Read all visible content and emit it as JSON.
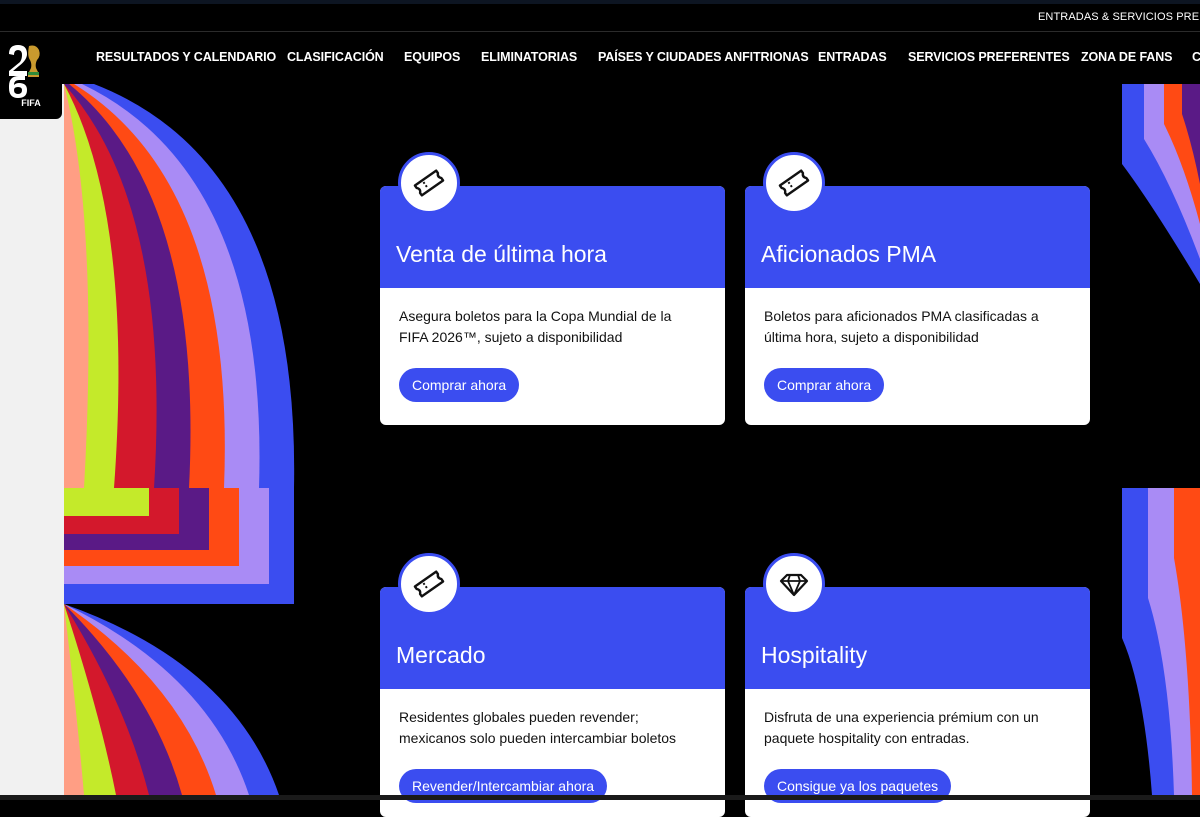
{
  "topbar": {
    "link": "ENTRADAS & SERVICIOS PREFERE"
  },
  "logo": {
    "text": "FIFA",
    "numerals": "26"
  },
  "nav": {
    "items": [
      "RESULTADOS Y CALENDARIO",
      "CLASIFICACIÓN",
      "EQUIPOS",
      "ELIMINATORIAS",
      "PAÍSES Y CIUDADES ANFITRIONAS",
      "ENTRADAS",
      "SERVICIOS PREFERENTES",
      "ZONA DE FANS",
      "C"
    ]
  },
  "cards": [
    {
      "icon": "ticket-icon",
      "title": "Venta de última hora",
      "desc": "Asegura boletos para la Copa Mundial de la FIFA 2026™, sujeto a disponibilidad",
      "button": "Comprar ahora"
    },
    {
      "icon": "ticket-icon",
      "title": "Aficionados PMA",
      "desc": "Boletos para aficionados PMA clasificadas a última hora, sujeto a disponibilidad",
      "button": "Comprar ahora"
    },
    {
      "icon": "ticket-icon",
      "title": "Mercado",
      "desc": "Residentes globales pueden revender; mexicanos solo pueden intercambiar boletos",
      "button": "Revender/Intercambiar ahora"
    },
    {
      "icon": "diamond-icon",
      "title": "Hospitality",
      "desc": "Disfruta de una experiencia prémium con un paquete hospitality con entradas.",
      "button": "Consigue ya los paquetes"
    }
  ],
  "colors": {
    "accent": "#3b4df0",
    "background": "#000000",
    "stripes": [
      "#3b4df0",
      "#a98bf5",
      "#ff4a14",
      "#5a1a86",
      "#d3182c",
      "#c4ea2a",
      "#ff9e84"
    ]
  }
}
